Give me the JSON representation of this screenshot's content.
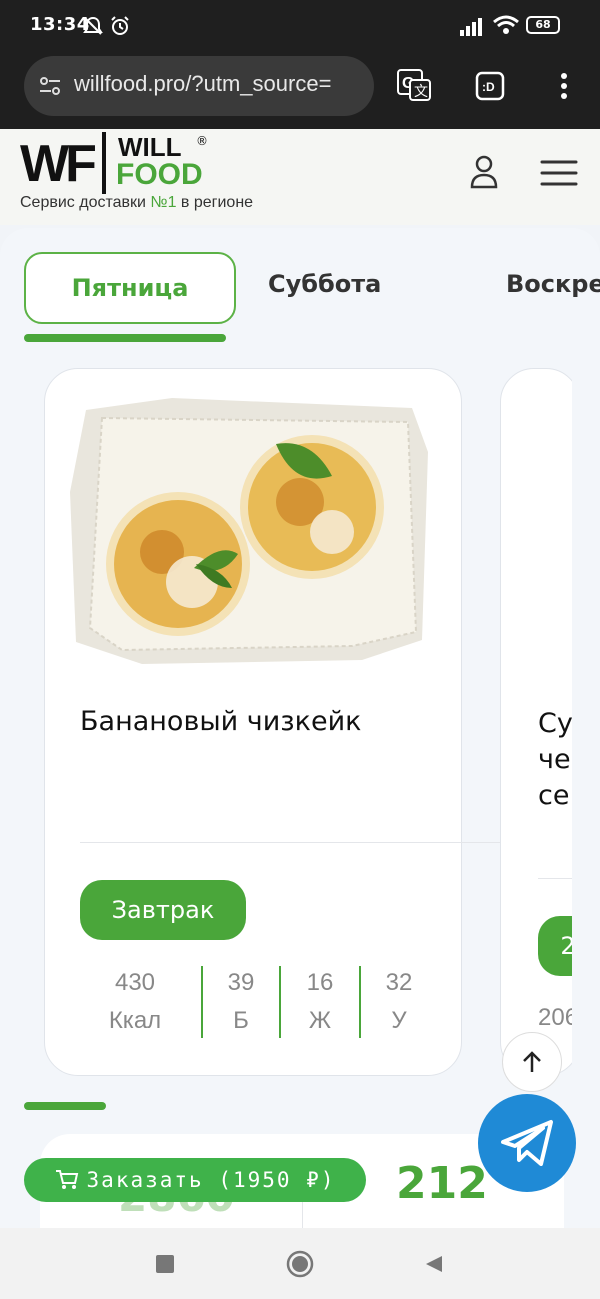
{
  "status_bar": {
    "time": "13:34",
    "battery": "68"
  },
  "browser": {
    "url": "willfood.pro/?utm_source="
  },
  "site": {
    "logo_mark": "WF",
    "logo_word1": "WILL",
    "logo_word2": "FOOD",
    "tagline_before": "Сервис доставки ",
    "tagline_highlight": "№1",
    "tagline_after": " в регионе"
  },
  "tabs": [
    {
      "label": "Пятница",
      "active": true
    },
    {
      "label": "Суббота"
    },
    {
      "label": "Воскре"
    }
  ],
  "card": {
    "title": "Банановый чизкейк",
    "meal_type": "Завтрак",
    "nutrition": [
      {
        "value": "430",
        "label": "Ккал"
      },
      {
        "value": "39",
        "label": "Б"
      },
      {
        "value": "16",
        "label": "Ж"
      },
      {
        "value": "32",
        "label": "У"
      }
    ]
  },
  "next_card": {
    "title_lines": [
      "Су",
      "чеч",
      "се."
    ],
    "pill_label": "2",
    "kcal": "206"
  },
  "card2": {
    "value": "212",
    "ghost": "2860"
  },
  "order_button": "Заказать (1950 ₽)",
  "colors": {
    "accent": "#4aa63a",
    "telegram": "#1f8ad6"
  }
}
